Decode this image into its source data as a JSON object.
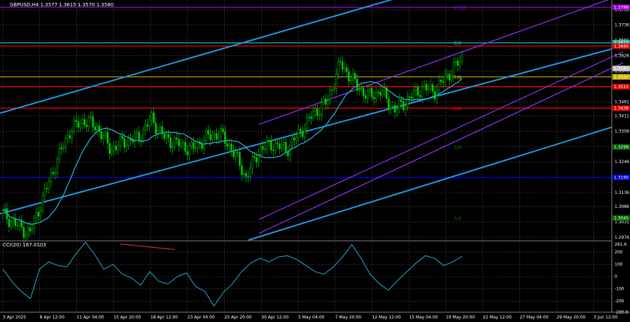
{
  "header": {
    "main": "GBPUSD,H4  1.3577 1.3615 1.3570 1.3580",
    "sub": "CCI(20) 167.0103"
  },
  "chart_data": [
    {
      "type": "candlestick",
      "symbol": "GBPUSD",
      "timeframe": "H4",
      "ylim": [
        1.2966,
        1.3825
      ],
      "y_ticks": [
        "1.3790",
        "1.3736",
        "1.3681",
        "1.3626",
        "1.3571",
        "1.3516",
        "1.3461",
        "1.3411",
        "1.3356",
        "1.3301",
        "1.3246",
        "1.3191",
        "1.3136",
        "1.3086",
        "1.3031",
        "1.2976"
      ],
      "x_ticks": [
        "3 Apr 2025",
        "8 Apr 12:00",
        "11 Apr 04:00",
        "15 Apr 20:00",
        "18 Apr 12:00",
        "23 Apr 04:00",
        "25 Apr 20:00",
        "30 Apr 12:00",
        "5 May 04:00",
        "7 May 20:00",
        "12 May 12:00",
        "15 May 04:00",
        "19 May 20:00",
        "22 May 12:00",
        "27 May 04:00",
        "29 May 20:00",
        "3 Jun 12:00"
      ],
      "closes": [
        1.306,
        1.302,
        1.299,
        1.312,
        1.325,
        1.336,
        1.3395,
        1.337,
        1.329,
        1.332,
        1.333,
        1.34,
        1.333,
        1.331,
        1.329,
        1.333,
        1.335,
        1.329,
        1.319,
        1.329,
        1.331,
        1.329,
        1.335,
        1.342,
        1.346,
        1.36,
        1.353,
        1.348,
        1.35,
        1.343,
        1.347,
        1.351,
        1.35,
        1.356,
        1.3615
      ],
      "price_labels": [
        {
          "value": "1.3799",
          "color": "#9900cc"
        },
        {
          "value": "1.3672",
          "color": "#1abc9c"
        },
        {
          "value": "1.3660",
          "color": "#e00000"
        },
        {
          "value": "1.3580",
          "color": "#c0c0c0"
        },
        {
          "value": "1.3550",
          "color": "#c8b400"
        },
        {
          "value": "1.3515",
          "color": "#e00000"
        },
        {
          "value": "1.3438",
          "color": "#e00000"
        },
        {
          "value": "1.3299",
          "color": "#006400"
        },
        {
          "value": "1.3190",
          "color": "#0000cc"
        },
        {
          "value": "1.3045",
          "color": "#006400"
        }
      ],
      "horizontal_levels": [
        {
          "value": 1.3799,
          "color": "#9900cc"
        },
        {
          "value": 1.3672,
          "color": "#00ced1"
        },
        {
          "value": 1.366,
          "color": "#ff0000"
        },
        {
          "value": 1.355,
          "color": "#c8b400"
        },
        {
          "value": 1.3515,
          "color": "#ff0000"
        },
        {
          "value": 1.3438,
          "color": "#ff0000"
        },
        {
          "value": 1.319,
          "color": "#0000ff"
        }
      ],
      "level_labels": [
        {
          "text": "+1/8",
          "value": 1.3799,
          "color": "#9900cc"
        },
        {
          "text": "8/8",
          "value": 1.3672,
          "color": "#1abc9c"
        },
        {
          "text": "7/8",
          "value": 1.355,
          "color": "#c8b400"
        },
        {
          "text": "6/8",
          "value": 1.3438,
          "color": "#e00000"
        },
        {
          "text": "5/8",
          "value": 1.3299,
          "color": "#006400"
        },
        {
          "text": "4/8",
          "value": 1.319,
          "color": "#0000cc"
        },
        {
          "text": "3/8",
          "value": 1.3045,
          "color": "#006400"
        }
      ],
      "colors": {
        "candle": "#00cc00",
        "ma": "#20b0d0",
        "trend": "#1e9be6",
        "channel": "#9b30ff",
        "grid": "#4a4a4a"
      }
    },
    {
      "type": "line",
      "name": "CCI(20)",
      "ylim": [
        -290,
        280
      ],
      "y_ticks": [
        "261.6",
        "200",
        "100",
        "0",
        "-100",
        "-200",
        "-289.8"
      ],
      "values": [
        60,
        -40,
        -120,
        -180,
        60,
        120,
        90,
        80,
        190,
        280,
        180,
        60,
        100,
        20,
        -10,
        -70,
        40,
        -40,
        -60,
        0,
        30,
        -80,
        -120,
        -240,
        -130,
        -60,
        40,
        110,
        150,
        120,
        160,
        170,
        140,
        90,
        40,
        20,
        80,
        160,
        260,
        150,
        20,
        -60,
        -110,
        -30,
        40,
        110,
        170,
        150,
        90,
        120,
        165
      ]
    }
  ]
}
